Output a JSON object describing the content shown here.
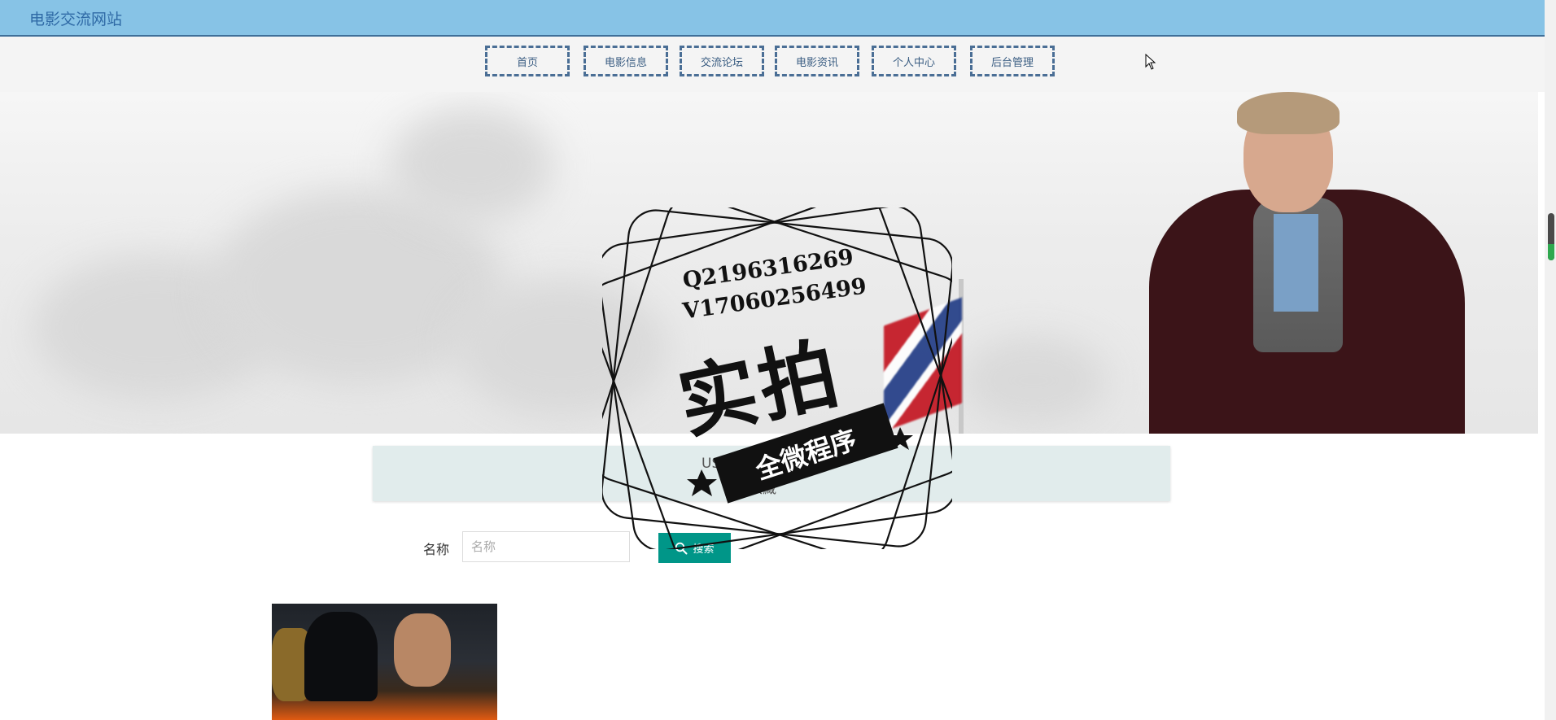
{
  "header": {
    "site_title": "电影交流网站"
  },
  "nav": {
    "items": [
      {
        "label": "首页"
      },
      {
        "label": "电影信息"
      },
      {
        "label": "交流论坛"
      },
      {
        "label": "电影资讯"
      },
      {
        "label": "个人中心"
      },
      {
        "label": "后台管理"
      }
    ]
  },
  "info_bar": {
    "line1": "US",
    "line2": "收藏"
  },
  "search": {
    "label": "名称",
    "placeholder": "名称",
    "value": "",
    "button_label": "搜索"
  },
  "watermark": {
    "line1": "Q2196316269",
    "line2": "V17060256499",
    "big": "实拍",
    "ribbon": "全微程序"
  },
  "colors": {
    "topbar": "#87c3e6",
    "nav_border": "#4a6e95",
    "search_button": "#009688",
    "info_bar": "#e1ecec"
  }
}
